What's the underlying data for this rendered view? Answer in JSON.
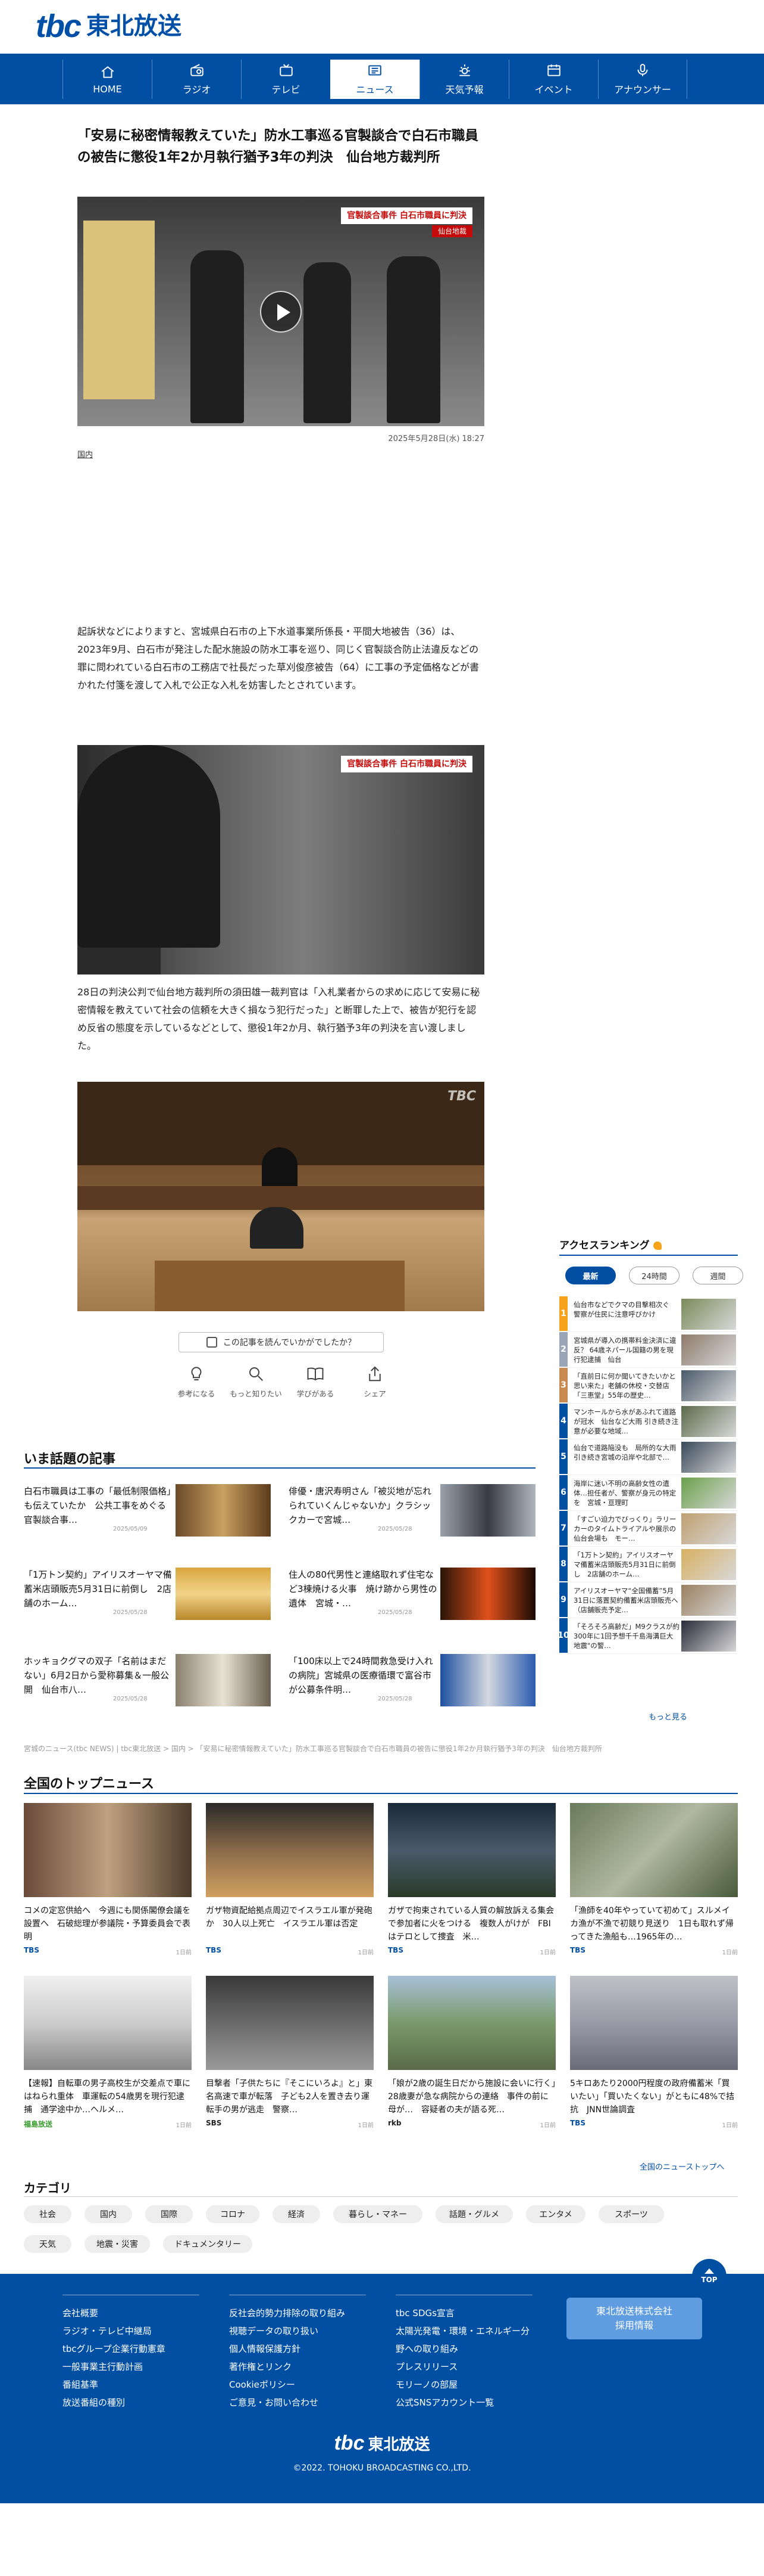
{
  "header": {
    "logo_mark": "tbc",
    "logo_text": "東北放送"
  },
  "nav": [
    {
      "label": "HOME",
      "icon": "home-icon"
    },
    {
      "label": "ラジオ",
      "icon": "radio-icon"
    },
    {
      "label": "テレビ",
      "icon": "tv-icon"
    },
    {
      "label": "ニュース",
      "icon": "news-icon"
    },
    {
      "label": "天気予報",
      "icon": "weather-icon"
    },
    {
      "label": "イベント",
      "icon": "calendar-icon"
    },
    {
      "label": "アナウンサー",
      "icon": "microphone-icon"
    }
  ],
  "article": {
    "title": "「安易に秘密情報教えていた」防水工事巡る官製談合で白石市職員の被告に懲役1年2か月執行猶予3年の判決　仙台地方裁判所",
    "video_caption": "官製談合事件 白石市職員に判決",
    "video_caption_sub": "仙台地裁",
    "date": "2025年5月28日(水) 18:27",
    "category": "国内",
    "paragraph1": "起訴状などによりますと、宮城県白石市の上下水道事業所係長・平間大地被告（36）は、2023年9月、白石市が発注した配水施設の防水工事を巡り、同じく官製談合防止法違反などの罪に問われている白石市の工務店で社長だった草刈俊彦被告（64）に工事の予定価格などが書かれた付箋を渡して入札で公正な入札を妨害したとされています。",
    "photo1_caption": "官製談合事件 白石市職員に判決",
    "paragraph2": "28日の判決公判で仙台地方裁判所の須田雄一裁判官は「入札業者からの求めに応じて安易に秘密情報を教えていて社会の信頼を大きく損なう犯行だった」と断罪した上で、被告が犯行を認め反省の態度を示しているなどとして、懲役1年2か月、執行猶予3年の判決を言い渡しました。",
    "watermark": "TBC"
  },
  "reactions": {
    "prompt": "この記事を読んでいかがでしたか？",
    "items": [
      {
        "label": "参考になる",
        "icon": "lightbulb-icon"
      },
      {
        "label": "もっと知りたい",
        "icon": "magnifier-icon"
      },
      {
        "label": "学びがある",
        "icon": "book-icon"
      },
      {
        "label": "シェア",
        "icon": "share-icon"
      }
    ]
  },
  "trending": {
    "title": "いま話題の記事",
    "items": [
      {
        "title": "白石市職員は工事の「最低制限価格」も伝えていたか　公共工事をめぐる官製談合事…",
        "date": "2025/05/09"
      },
      {
        "title": "俳優・唐沢寿明さん「被災地が忘れられていくんじゃないか」クラシックカーで宮城…",
        "date": "2025/05/28"
      },
      {
        "title": "「1万トン契約」アイリスオーヤマ備蓄米店頭販売5月31日に前倒し　2店舗のホーム…",
        "date": "2025/05/28"
      },
      {
        "title": "住人の80代男性と連絡取れず住宅など3棟焼ける火事　焼け跡から男性の遺体　宮城・…",
        "date": "2025/05/28"
      },
      {
        "title": "ホッキョクグマの双子「名前はまだない」6月2日から愛称募集＆一般公開　仙台市八…",
        "date": "2025/05/28"
      },
      {
        "title": "「100床以上で24時間救急受け入れの病院」宮城県の医療循環で富谷市が公募条件明…",
        "date": "2025/05/28"
      }
    ]
  },
  "breadcrumb": "宮城のニュース(tbc NEWS) | tbc東北放送 > 国内 > 「安易に秘密情報教えていた」防水工事巡る官製談合で白石市職員の被告に懲役1年2か月執行猶予3年の判決　仙台地方裁判所",
  "ranking": {
    "title": "アクセスランキング",
    "tabs": [
      "最新",
      "24時間",
      "週間"
    ],
    "items": [
      {
        "num": "1",
        "color": "#f6a21a",
        "text": "仙台市などでクマの目撃相次ぐ　警察が住民に注意呼びかけ"
      },
      {
        "num": "2",
        "color": "#9aa6b8",
        "text": "宮城県が導入の携帯料金決済に違反？ 64歳ネパール国籍の男を現行犯逮捕　仙台"
      },
      {
        "num": "3",
        "color": "#c98a52",
        "text": "「直前日に何か聞いてきたいかと思い来た」老舗の休校・交替店「三恵堂」55年の歴史…"
      },
      {
        "num": "4",
        "color": "#004fa3",
        "text": "マンホールから水があふれて道路が冠水　仙台など大雨 引き続き注意が必要な地域…"
      },
      {
        "num": "5",
        "color": "#004fa3",
        "text": "仙台で道路陥没も　局所的な大雨 引き続き宮城の沿岸や北部で…"
      },
      {
        "num": "6",
        "color": "#004fa3",
        "text": "海岸に迷い不明の高齢女性の遺体…担任者が、警察が身元の特定を　宮城・亘理町"
      },
      {
        "num": "7",
        "color": "#004fa3",
        "text": "「すごい迫力でびっくり」ラリーカーのタイムトライアルや展示の仙台会場も　モー…"
      },
      {
        "num": "8",
        "color": "#004fa3",
        "text": "「1万トン契約」アイリスオーヤマ備蓄米店頭販売5月31日に前倒し　2店舗のホーム…"
      },
      {
        "num": "9",
        "color": "#004fa3",
        "text": "アイリスオーヤマ“全国備蓄”5月31日に落置契約備蓄米店頭販売へ（店舗販売予定…"
      },
      {
        "num": "10",
        "color": "#004fa3",
        "text": "「そろそろ高齢だ」M9クラスが約300年に1回予想千千島海溝巨大地震\"の警…"
      }
    ],
    "more": "もっと見る"
  },
  "national": {
    "title": "全国のトップニュース",
    "items": [
      {
        "title": "コメの定窓供給へ　今週にも関係閣僚会議を設置へ　石破総理が参議院・予算委員会で表明",
        "source": "TBS",
        "time": "1日前"
      },
      {
        "title": "ガザ物資配給拠点周辺でイスラエル軍が発砲か　30人以上死亡　イスラエル軍は否定",
        "source": "TBS",
        "time": "1日前"
      },
      {
        "title": "ガザで拘束されている人質の解放訴える集会で参加者に火をつける　複数人がけが　FBIはテロとして捜査　米…",
        "source": "TBS",
        "time": "1日前"
      },
      {
        "title": "「漁師を40年やっていて初めて」スルメイカ漁が不漁で初競り見送り　1日も取れず帰ってきた漁船も…1965年の…",
        "source": "TBS",
        "time": "1日前"
      },
      {
        "title": "【速報】自転車の男子高校生が交差点で車にはねられ重体　車運転の54歳男を現行犯逮捕　通学途中か…ヘルメ…",
        "source": "福島放送",
        "time": "1日前",
        "color": "green"
      },
      {
        "title": "目撃者「子供たちに『そこにいろよ』と」東名高速で車が転落　子ども2人を置き去り運転手の男が逃走　警察…",
        "source": "SBS",
        "time": "1日前",
        "color": "dark"
      },
      {
        "title": "「娘が2歳の誕生日だから施設に会いに行く」28歳妻が急な病院からの連絡　事件の前に母が…　容疑者の夫が語る死…",
        "source": "rkb",
        "time": "1日前",
        "color": "dark"
      },
      {
        "title": "5キロあたり2000円程度の政府備蓄米「買いたい」「買いたくない」がともに48%で拮抗　JNN世論調査",
        "source": "TBS",
        "time": "1日前"
      }
    ],
    "more": "全国のニューストップへ"
  },
  "categories": {
    "title": "カテゴリ",
    "items": [
      "社会",
      "国内",
      "国際",
      "コロナ",
      "経済",
      "暮らし・マネー",
      "話題・グルメ",
      "エンタメ",
      "スポーツ",
      "天気",
      "地震・災害",
      "ドキュメンタリー"
    ]
  },
  "footer": {
    "to_top": "TOP",
    "col1": [
      "会社概要",
      "ラジオ・テレビ中継局",
      "tbcグループ企業行動憲章",
      "一般事業主行動計画",
      "番組基準",
      "放送番組の種別"
    ],
    "col2": [
      "反社会的勢力排除の取り組み",
      "視聴データの取り扱い",
      "個人情報保護方針",
      "著作権とリンク",
      "Cookieポリシー",
      "ご意見・お問い合わせ"
    ],
    "col3": [
      "tbc SDGs宣言",
      "太陽光発電・環境・エネルギー分野への取り組み",
      "プレスリリース",
      "モリーノの部屋",
      "公式SNSアカウント一覧"
    ],
    "recruit": "東北放送株式会社\n採用情報",
    "logo_mark": "tbc",
    "logo_text": "東北放送",
    "copyright": "©2022. TOHOKU BROADCASTING CO.,LTD."
  }
}
